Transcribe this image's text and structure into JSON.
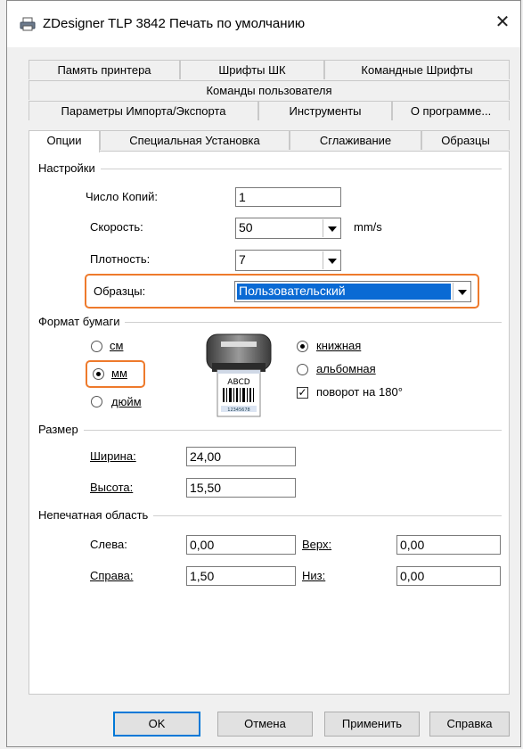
{
  "window": {
    "title": "ZDesigner TLP 3842 Печать по умолчанию",
    "close_symbol": "✕"
  },
  "tabs": {
    "row1": [
      "Память принтера",
      "Шрифты ШК",
      "Командные Шрифты"
    ],
    "row2": [
      "Команды пользователя"
    ],
    "row3": [
      "Параметры Импорта/Экспорта",
      "Инструменты",
      "О программе..."
    ],
    "row4": [
      "Опции",
      "Специальная Установка",
      "Сглаживание",
      "Образцы"
    ],
    "active": "Опции"
  },
  "settings": {
    "group_title": "Настройки",
    "copies_label": "Число Копий:",
    "copies_value": "1",
    "speed_label": "Скорость:",
    "speed_value": "50",
    "speed_unit": "mm/s",
    "density_label": "Плотность:",
    "density_value": "7",
    "samples_label": "Образцы:",
    "samples_value": "Пользовательский"
  },
  "paper": {
    "group_title": "Формат бумаги",
    "unit_cm": "см",
    "unit_mm": "мм",
    "unit_inch": "дюйм",
    "selected_unit": "мм",
    "orientation_portrait": "книжная",
    "orientation_landscape": "альбомная",
    "selected_orientation": "книжная",
    "rotate_label": "поворот на 180°",
    "rotate_checked": true,
    "label_preview_text": "ABCD",
    "label_preview_number": "12345678"
  },
  "size": {
    "group_title": "Размер",
    "width_label": "Ширина:",
    "width_value": "24,00",
    "height_label": "Высота:",
    "height_value": "15,50"
  },
  "unprintable": {
    "group_title": "Непечатная область",
    "left_label": "Слева:",
    "left_value": "0,00",
    "right_label": "Справа:",
    "right_value": "1,50",
    "top_label": "Верх:",
    "top_value": "0,00",
    "bottom_label": "Низ:",
    "bottom_value": "0,00"
  },
  "buttons": {
    "ok": "OK",
    "cancel": "Отмена",
    "apply": "Применить",
    "help": "Справка"
  },
  "colors": {
    "highlight": "#ee7a2c",
    "selection": "#0a6ad4"
  }
}
